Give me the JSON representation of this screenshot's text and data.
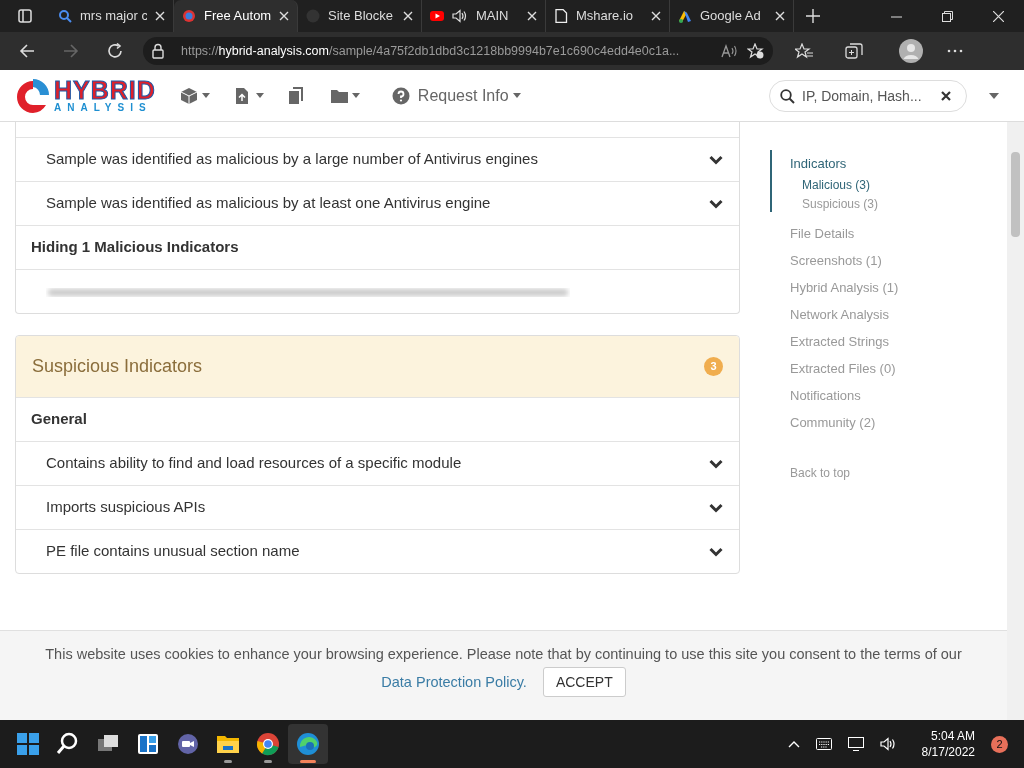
{
  "browser": {
    "tabs": [
      {
        "title": "mrs major c",
        "selected": false
      },
      {
        "title": "Free Autom",
        "selected": true
      },
      {
        "title": "Site Blocke",
        "selected": false
      },
      {
        "title": "MAIN",
        "selected": false
      },
      {
        "title": "Mshare.io",
        "selected": false
      },
      {
        "title": "Google Ad",
        "selected": false
      }
    ],
    "url": "https://**hybrid-analysis.com**/sample/4a75f2db1dbd3c1218bb9994b7e1c690c4edd4e0c1a..."
  },
  "header": {
    "logo": {
      "top": "HYBRID",
      "bottom": "ANALYSIS"
    },
    "nav": [
      {
        "kind": "cube",
        "caret": true
      },
      {
        "kind": "file",
        "caret": true
      },
      {
        "kind": "copy",
        "caret": false
      },
      {
        "kind": "folder",
        "caret": true
      },
      {
        "kind": "question",
        "label": "Request Info",
        "caret": true
      }
    ],
    "search": {
      "placeholder": "IP, Domain, Hash..."
    }
  },
  "malicious": {
    "rows": [
      {
        "kind": "indicator",
        "text": "Sample was identified as malicious by a large number of Antivirus engines"
      },
      {
        "kind": "indicator",
        "text": "Sample was identified as malicious by at least one Antivirus engine"
      },
      {
        "kind": "heading",
        "text": "Hiding 1 Malicious Indicators"
      },
      {
        "kind": "blurred"
      }
    ]
  },
  "suspicious": {
    "title": "Suspicious Indicators",
    "count": "3",
    "rows": [
      {
        "kind": "heading",
        "text": "General"
      },
      {
        "kind": "indicator",
        "text": "Contains ability to find and load resources of a specific module"
      },
      {
        "kind": "indicator",
        "text": "Imports suspicious APIs"
      },
      {
        "kind": "indicator",
        "text": "PE file contains unusual section name"
      }
    ]
  },
  "sidebar": {
    "items": [
      {
        "label": "Indicators",
        "selected": true,
        "children": [
          {
            "label": "Malicious (3)",
            "selected": true
          },
          {
            "label": "Suspicious (3)",
            "selected": false
          }
        ]
      },
      {
        "label": "File Details",
        "selected": false
      },
      {
        "label": "Screenshots (1)",
        "selected": false
      },
      {
        "label": "Hybrid Analysis (1)",
        "selected": false
      },
      {
        "label": "Network Analysis",
        "selected": false
      },
      {
        "label": "Extracted Strings",
        "selected": false
      },
      {
        "label": "Extracted Files (0)",
        "selected": false
      },
      {
        "label": "Notifications",
        "selected": false
      },
      {
        "label": "Community (2)",
        "selected": false
      }
    ],
    "back": "Back to top"
  },
  "cookie": {
    "text": "This website uses cookies to enhance your browsing experience. Please note that by continuing to use this site you consent to the terms of our",
    "link": "Data Protection Policy.",
    "button": "ACCEPT"
  },
  "taskbar": {
    "apps": [
      {
        "kind": "start",
        "running": false,
        "active": false
      },
      {
        "kind": "search",
        "running": false,
        "active": false
      },
      {
        "kind": "taskview",
        "running": false,
        "active": false
      },
      {
        "kind": "widgets",
        "running": false,
        "active": false
      },
      {
        "kind": "chat",
        "running": false,
        "active": false
      },
      {
        "kind": "explorer",
        "running": true,
        "active": false
      },
      {
        "kind": "chrome",
        "running": true,
        "active": false
      },
      {
        "kind": "edge",
        "running": true,
        "active": true
      }
    ],
    "time": "5:04 AM",
    "date": "8/17/2022",
    "badge": "2"
  }
}
